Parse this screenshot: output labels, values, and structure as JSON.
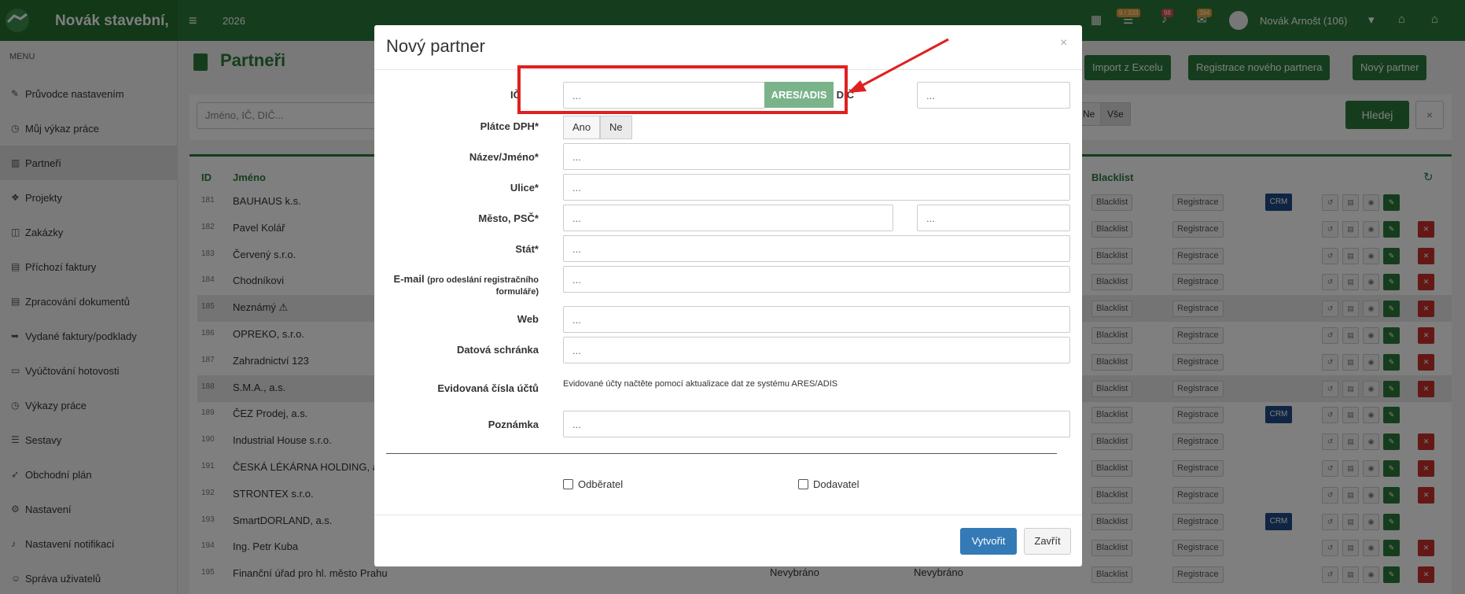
{
  "topbar": {
    "brand": "Novák stavební,",
    "year": "2026",
    "badges": [
      "9 / 333",
      "98",
      "394"
    ],
    "user": "Novák Arnošt (106)"
  },
  "sidebar": {
    "title": "MENU",
    "items": [
      {
        "label": "Průvodce nastavením",
        "icon": "pencil-icon"
      },
      {
        "label": "Můj výkaz práce",
        "icon": "clock-icon"
      },
      {
        "label": "Partneři",
        "icon": "building-icon"
      },
      {
        "label": "Projekty",
        "icon": "cubes-icon"
      },
      {
        "label": "Zakázky",
        "icon": "box-icon"
      },
      {
        "label": "Příchozí faktury",
        "icon": "document-icon"
      },
      {
        "label": "Zpracování dokumentů",
        "icon": "document-icon"
      },
      {
        "label": "Vydané faktury/podklady",
        "icon": "share-icon"
      },
      {
        "label": "Vyúčtování hotovosti",
        "icon": "money-icon"
      },
      {
        "label": "Výkazy práce",
        "icon": "clock-icon"
      },
      {
        "label": "Sestavy",
        "icon": "list-icon"
      },
      {
        "label": "Obchodní plán",
        "icon": "rocket-icon"
      },
      {
        "label": "Nastavení",
        "icon": "gears-icon"
      },
      {
        "label": "Nastavení notifikací",
        "icon": "bell-icon"
      },
      {
        "label": "Správa uživatelů",
        "icon": "users-icon"
      }
    ]
  },
  "page": {
    "title": "Partneři",
    "buttons": {
      "import": "Import z Excelu",
      "registration": "Registrace nového partnera",
      "new": "Nový partner"
    },
    "search_placeholder": "Jméno, IČ, DIČ...",
    "filter_ne": "Ne",
    "filter_all": "Vše",
    "search_button": "Hledej",
    "clear_button": "×"
  },
  "table": {
    "headers": {
      "id": "ID",
      "name": "Jméno",
      "blacklist": "Blacklist"
    },
    "blacklist_label": "Blacklist",
    "registration_label": "Registrace",
    "crm_label": "CRM",
    "extra_labels": {
      "col_a": "Nevybráno",
      "col_b": "Nevybráno"
    },
    "rows": [
      {
        "id": "181",
        "name": "BAUHAUS k.s.",
        "crm": true,
        "delete": false,
        "highlight": false
      },
      {
        "id": "182",
        "name": "Pavel Kolář",
        "crm": false,
        "delete": true,
        "highlight": false
      },
      {
        "id": "183",
        "name": "Červený s.r.o.",
        "crm": false,
        "delete": true,
        "highlight": false
      },
      {
        "id": "184",
        "name": "Chodníkovi",
        "crm": false,
        "delete": true,
        "highlight": false
      },
      {
        "id": "185",
        "name": "Neznámý ⚠",
        "crm": false,
        "delete": true,
        "highlight": true
      },
      {
        "id": "186",
        "name": "OPREKO, s.r.o.",
        "crm": false,
        "delete": true,
        "highlight": false
      },
      {
        "id": "187",
        "name": "Zahradnictví 123",
        "crm": false,
        "delete": true,
        "highlight": false
      },
      {
        "id": "188",
        "name": "S.M.A., a.s.",
        "crm": false,
        "delete": true,
        "highlight": true
      },
      {
        "id": "189",
        "name": "ČEZ Prodej, a.s.",
        "crm": true,
        "delete": false,
        "highlight": false
      },
      {
        "id": "190",
        "name": "Industrial House s.r.o.",
        "crm": false,
        "delete": true,
        "highlight": false
      },
      {
        "id": "191",
        "name": "ČESKÁ LÉKÁRNA HOLDING, a.s.",
        "crm": false,
        "delete": true,
        "highlight": false
      },
      {
        "id": "192",
        "name": "STRONTEX s.r.o.",
        "crm": false,
        "delete": true,
        "highlight": false
      },
      {
        "id": "193",
        "name": "SmartDORLAND, a.s.",
        "crm": true,
        "delete": false,
        "highlight": false
      },
      {
        "id": "194",
        "name": "Ing. Petr Kuba",
        "crm": false,
        "delete": true,
        "highlight": false
      },
      {
        "id": "195",
        "name": "Finanční úřad pro hl. město Prahu",
        "crm": false,
        "delete": true,
        "highlight": false
      }
    ]
  },
  "modal": {
    "title": "Nový partner",
    "close": "×",
    "ic_label": "IČ",
    "ic_placeholder": "...",
    "ares_button": "ARES/ADIS",
    "dic_label": "DIČ",
    "dic_placeholder": "...",
    "vat_label": "Plátce DPH*",
    "vat_yes": "Ano",
    "vat_no": "Ne",
    "name_label": "Název/Jméno*",
    "name_placeholder": "...",
    "street_label": "Ulice*",
    "street_placeholder": "...",
    "city_label": "Město, PSČ*",
    "city_placeholder": "...",
    "zip_placeholder": "...",
    "country_label": "Stát*",
    "country_placeholder": "...",
    "email_label": "E-mail",
    "email_hint": "(pro odeslání registračního formuláře)",
    "email_placeholder": "...",
    "web_label": "Web",
    "web_placeholder": "...",
    "databox_label": "Datová schránka",
    "databox_placeholder": "...",
    "accounts_label": "Evidovaná čísla účtů",
    "accounts_note": "Evidované účty načtěte pomocí aktualizace dat ze systému ARES/ADIS",
    "note_label": "Poznámka",
    "note_placeholder": "...",
    "customer_label": "Odběratel",
    "supplier_label": "Dodavatel",
    "create_button": "Vytvořit",
    "close_button": "Zavřít"
  },
  "colors": {
    "brand": "#2b7a3b",
    "primary": "#337ab7",
    "annotation": "#e02020"
  }
}
